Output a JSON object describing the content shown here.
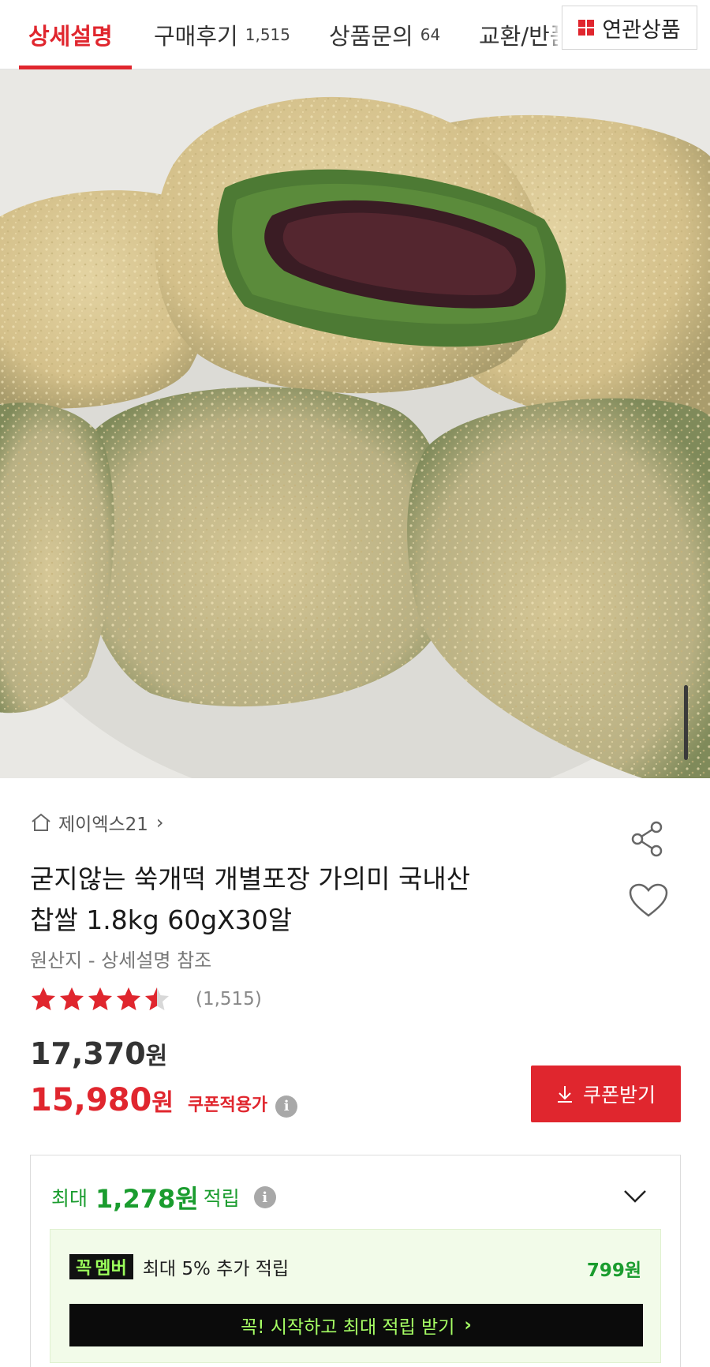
{
  "tabs": [
    {
      "label": "상세설명",
      "count": ""
    },
    {
      "label": "구매후기",
      "count": "1,515"
    },
    {
      "label": "상품문의",
      "count": "64"
    },
    {
      "label": "교환/반품",
      "count": ""
    }
  ],
  "related_label": "연관상품",
  "store": {
    "name": "제이엑스21",
    "chevron": "›"
  },
  "product": {
    "title_line1": "굳지않는 쑥개떡 개별포장 가의미 국내산",
    "title_line2": "찹쌀 1.8kg 60gX30알",
    "origin": "원산지 - 상세설명 참조"
  },
  "rating": {
    "stars": 4.5,
    "max": 5,
    "count_text": "(1,515)"
  },
  "price": {
    "original": "17,370",
    "sale": "15,980",
    "currency": "원",
    "coupon_applied_label": "쿠폰적용가"
  },
  "coupon_button_label": "쿠폰받기",
  "points": {
    "label": "최대",
    "amount": "1,278원",
    "suffix": "적립"
  },
  "member": {
    "badge_part1": "꼭",
    "badge_part2": "멤버",
    "text": "최대 5% 추가 적립",
    "amount": "799원",
    "cta": "꼭! 시작하고 최대 적립 받기"
  },
  "colors": {
    "accent": "#e0262e",
    "points_green": "#1a9c2e",
    "member_bg": "#f2fbe9",
    "member_cta_text": "#a6ff64"
  },
  "icons": [
    "grid-icon",
    "home-icon",
    "share-icon",
    "heart-icon",
    "star-icon",
    "info-icon",
    "download-icon",
    "chevron-down-icon"
  ]
}
